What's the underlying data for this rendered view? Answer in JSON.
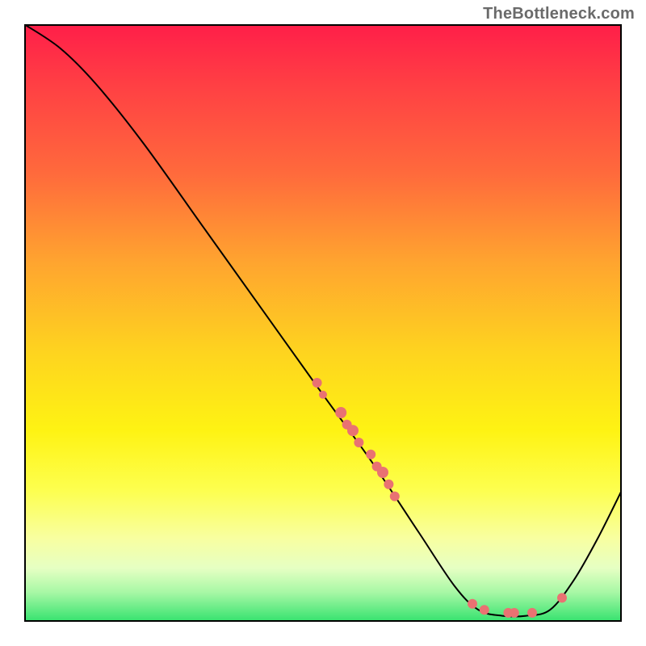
{
  "watermark": "TheBottleneck.com",
  "chart_data": {
    "type": "line",
    "title": "",
    "xlabel": "",
    "ylabel": "",
    "xlim": [
      0,
      100
    ],
    "ylim": [
      0,
      100
    ],
    "grid": false,
    "legend": false,
    "curve": [
      {
        "x": 0,
        "y": 100
      },
      {
        "x": 6,
        "y": 96
      },
      {
        "x": 12,
        "y": 90
      },
      {
        "x": 20,
        "y": 80
      },
      {
        "x": 30,
        "y": 66
      },
      {
        "x": 40,
        "y": 52
      },
      {
        "x": 50,
        "y": 38
      },
      {
        "x": 58,
        "y": 27
      },
      {
        "x": 66,
        "y": 15
      },
      {
        "x": 72,
        "y": 6
      },
      {
        "x": 76,
        "y": 2
      },
      {
        "x": 80,
        "y": 1
      },
      {
        "x": 84,
        "y": 1
      },
      {
        "x": 88,
        "y": 2
      },
      {
        "x": 92,
        "y": 7
      },
      {
        "x": 96,
        "y": 14
      },
      {
        "x": 100,
        "y": 22
      }
    ],
    "markers": [
      {
        "x": 49,
        "y": 40,
        "r": 6
      },
      {
        "x": 50,
        "y": 38,
        "r": 5
      },
      {
        "x": 53,
        "y": 35,
        "r": 7
      },
      {
        "x": 54,
        "y": 33,
        "r": 6
      },
      {
        "x": 55,
        "y": 32,
        "r": 7
      },
      {
        "x": 56,
        "y": 30,
        "r": 6
      },
      {
        "x": 58,
        "y": 28,
        "r": 6
      },
      {
        "x": 59,
        "y": 26,
        "r": 6
      },
      {
        "x": 60,
        "y": 25,
        "r": 7
      },
      {
        "x": 61,
        "y": 23,
        "r": 6
      },
      {
        "x": 62,
        "y": 21,
        "r": 6
      },
      {
        "x": 75,
        "y": 3,
        "r": 6
      },
      {
        "x": 77,
        "y": 2,
        "r": 6
      },
      {
        "x": 81,
        "y": 1.5,
        "r": 6
      },
      {
        "x": 82,
        "y": 1.5,
        "r": 6
      },
      {
        "x": 85,
        "y": 1.5,
        "r": 6
      },
      {
        "x": 90,
        "y": 4,
        "r": 6
      }
    ],
    "background_gradient": {
      "orientation": "vertical",
      "stops": [
        {
          "pos": 0.0,
          "color": "#ff1e49"
        },
        {
          "pos": 0.25,
          "color": "#ff6a3c"
        },
        {
          "pos": 0.55,
          "color": "#fed41f"
        },
        {
          "pos": 0.78,
          "color": "#fdff4f"
        },
        {
          "pos": 0.95,
          "color": "#a9f8a6"
        },
        {
          "pos": 1.0,
          "color": "#34e26e"
        }
      ]
    }
  }
}
